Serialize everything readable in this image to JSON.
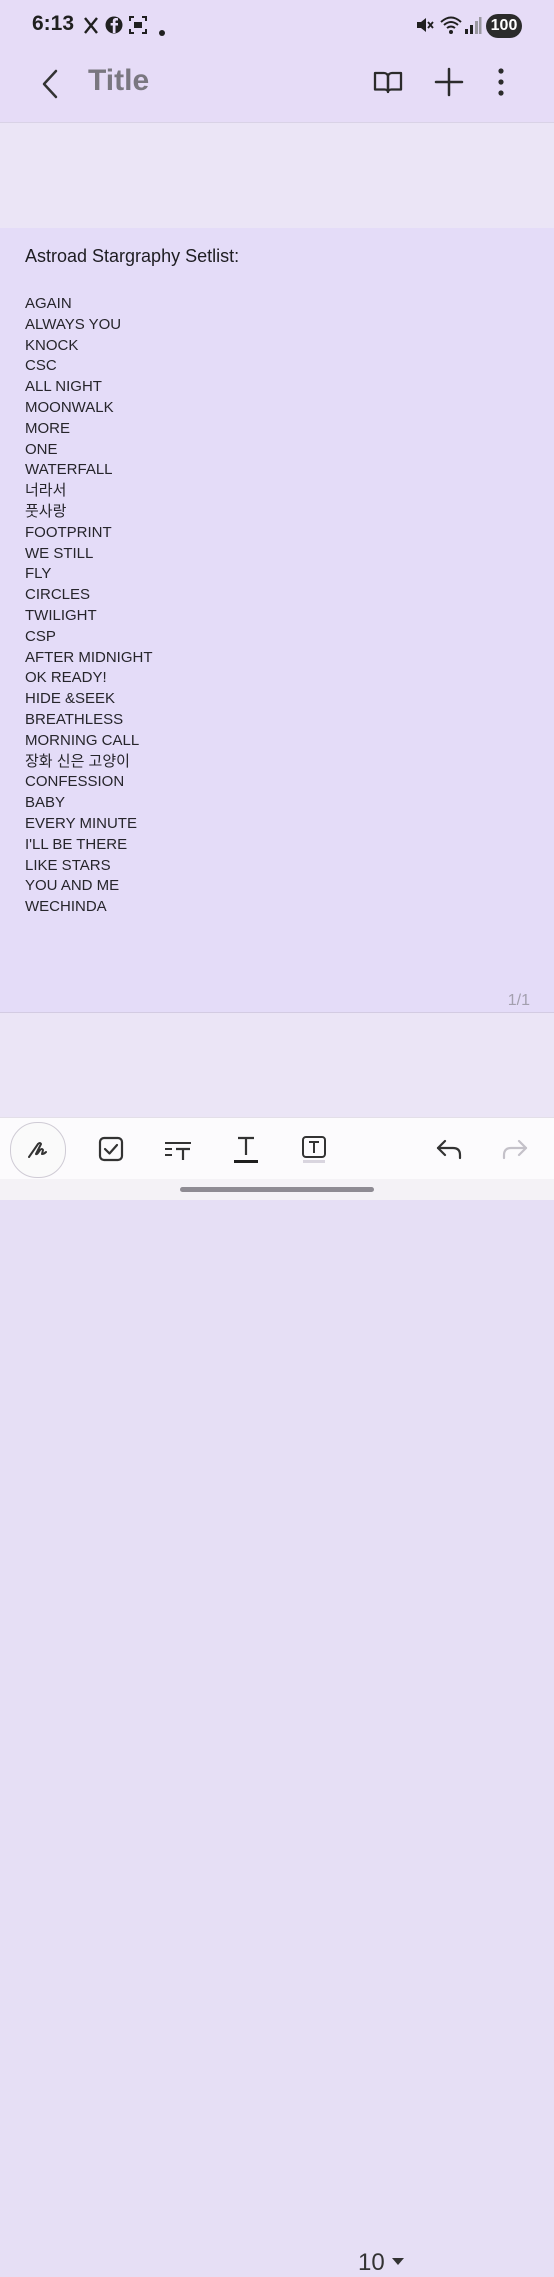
{
  "status_bar": {
    "time": "6:13",
    "battery": "100"
  },
  "app_bar": {
    "title": "Title"
  },
  "note": {
    "heading": "Astroad  Stargraphy Setlist:",
    "items": [
      "AGAIN",
      "ALWAYS YOU",
      "KNOCK",
      "CSC",
      "ALL NIGHT",
      "MOONWALK",
      "MORE",
      "ONE",
      "WATERFALL",
      "너라서",
      "풋사랑",
      "FOOTPRINT",
      "WE STILL",
      "FLY",
      "CIRCLES",
      "TWILIGHT",
      "CSP",
      "AFTER MIDNIGHT",
      "OK READY!",
      "HIDE &SEEK",
      "BREATHLESS",
      "MORNING CALL",
      "장화 신은 고양이",
      "CONFESSION",
      "BABY",
      "EVERY MINUTE",
      "I'LL BE THERE",
      "LIKE STARS",
      "YOU AND ME",
      "WECHINDA"
    ],
    "page_counter": "1/1"
  },
  "toolbar": {
    "font_size": "10"
  }
}
